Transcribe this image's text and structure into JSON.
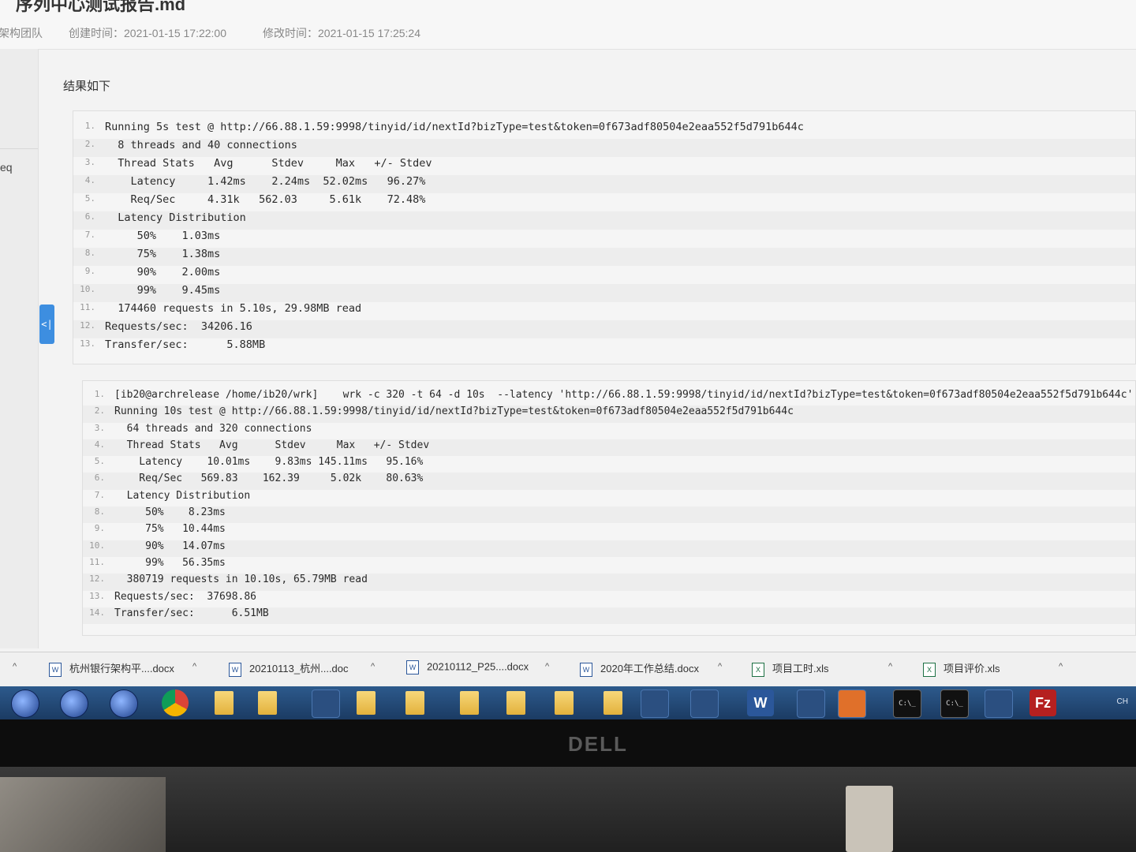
{
  "document": {
    "title": "序列中心测试报告.md",
    "team": "架构团队",
    "created": "创建时间：2021-01-15 17:22:00",
    "modified": "修改时间：2021-01-15 17:25:24"
  },
  "sidebar": {
    "text": "eq",
    "collapse_icon": "<|"
  },
  "content": {
    "heading": "结果如下",
    "block1": [
      {
        "n": "1.",
        "t": "Running 5s test @ http://66.88.1.59:9998/tinyid/id/nextId?bizType=test&token=0f673adf80504e2eaa552f5d791b644c"
      },
      {
        "n": "2.",
        "t": "  8 threads and 40 connections"
      },
      {
        "n": "3.",
        "t": "  Thread Stats   Avg      Stdev     Max   +/- Stdev"
      },
      {
        "n": "4.",
        "t": "    Latency     1.42ms    2.24ms  52.02ms   96.27%"
      },
      {
        "n": "5.",
        "t": "    Req/Sec     4.31k   562.03     5.61k    72.48%"
      },
      {
        "n": "6.",
        "t": "  Latency Distribution"
      },
      {
        "n": "7.",
        "t": "     50%    1.03ms"
      },
      {
        "n": "8.",
        "t": "     75%    1.38ms"
      },
      {
        "n": "9.",
        "t": "     90%    2.00ms"
      },
      {
        "n": "10.",
        "t": "     99%    9.45ms"
      },
      {
        "n": "11.",
        "t": "  174460 requests in 5.10s, 29.98MB read"
      },
      {
        "n": "12.",
        "t": "Requests/sec:  34206.16"
      },
      {
        "n": "13.",
        "t": "Transfer/sec:      5.88MB"
      }
    ],
    "block2": [
      {
        "n": "1.",
        "t": "[ib20@archrelease /home/ib20/wrk]    wrk -c 320 -t 64 -d 10s  --latency 'http://66.88.1.59:9998/tinyid/id/nextId?bizType=test&token=0f673adf80504e2eaa552f5d791b644c'"
      },
      {
        "n": "2.",
        "t": "Running 10s test @ http://66.88.1.59:9998/tinyid/id/nextId?bizType=test&token=0f673adf80504e2eaa552f5d791b644c"
      },
      {
        "n": "3.",
        "t": "  64 threads and 320 connections"
      },
      {
        "n": "4.",
        "t": "  Thread Stats   Avg      Stdev     Max   +/- Stdev"
      },
      {
        "n": "5.",
        "t": "    Latency    10.01ms    9.83ms 145.11ms   95.16%"
      },
      {
        "n": "6.",
        "t": "    Req/Sec   569.83    162.39     5.02k    80.63%"
      },
      {
        "n": "7.",
        "t": "  Latency Distribution"
      },
      {
        "n": "8.",
        "t": "     50%    8.23ms"
      },
      {
        "n": "9.",
        "t": "     75%   10.44ms"
      },
      {
        "n": "10.",
        "t": "     90%   14.07ms"
      },
      {
        "n": "11.",
        "t": "     99%   56.35ms"
      },
      {
        "n": "12.",
        "t": "  380719 requests in 10.10s, 65.79MB read"
      },
      {
        "n": "13.",
        "t": "Requests/sec:  37698.86"
      },
      {
        "n": "14.",
        "t": "Transfer/sec:      6.51MB"
      }
    ]
  },
  "downloads": [
    {
      "name": "杭州银行架构平....docx",
      "type": "W"
    },
    {
      "name": "20210113_杭州....doc",
      "type": "W"
    },
    {
      "name": "20210112_P25....docx",
      "type": "W"
    },
    {
      "name": "2020年工作总结.docx",
      "type": "W"
    },
    {
      "name": "项目工时.xls",
      "type": "X"
    },
    {
      "name": "项目评价.xls",
      "type": "X"
    }
  ],
  "download_caret": "^",
  "taskbar": {
    "word_label": "W",
    "filezilla_label": "Fz",
    "terminal_label": "C:\\_",
    "tray_text": "CH"
  },
  "monitor_brand": "DELL"
}
